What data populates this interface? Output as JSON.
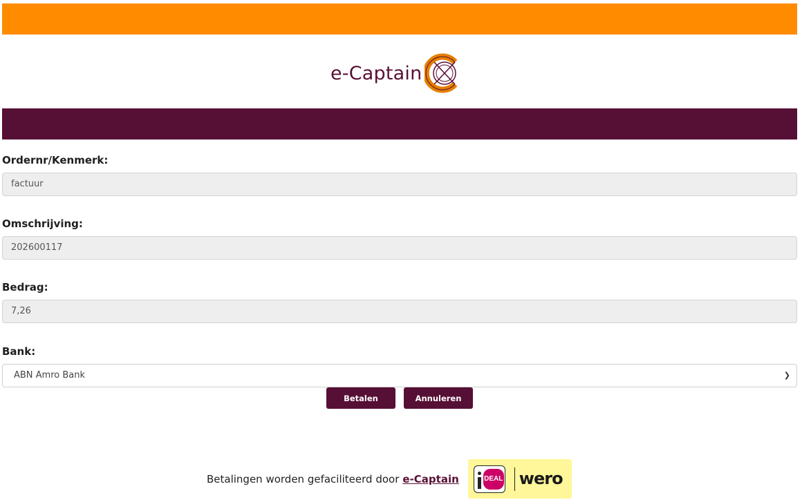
{
  "brand": {
    "logo_text": "e-Captain",
    "colors": {
      "orange": "#ff8c00",
      "purple": "#560f35",
      "logo_text": "#5a1036"
    }
  },
  "form": {
    "order": {
      "label": "Ordernr/Kenmerk:",
      "value": "factuur"
    },
    "description": {
      "label": "Omschrijving:",
      "value": "202600117"
    },
    "amount": {
      "label": "Bedrag:",
      "value": "7,26"
    },
    "bank": {
      "label": "Bank:",
      "selected": "ABN Amro Bank"
    }
  },
  "buttons": {
    "pay": "Betalen",
    "cancel": "Annuleren"
  },
  "footer": {
    "text": "Betalingen worden gefaciliteerd door",
    "link": "e-Captain",
    "ideal_label": "DEAL",
    "wero_label": "wero"
  }
}
